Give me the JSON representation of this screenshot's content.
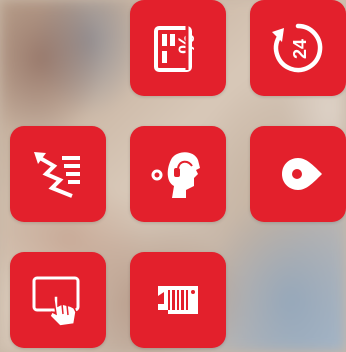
{
  "tiles": [
    {
      "id": "card-discount",
      "icon": "card-discount-icon",
      "symbol": "%"
    },
    {
      "id": "service-24h",
      "icon": "24-hour-service-icon",
      "symbol": "24"
    },
    {
      "id": "price-drop",
      "icon": "price-drop-chart-icon"
    },
    {
      "id": "customer-support",
      "icon": "support-agent-icon"
    },
    {
      "id": "store-location",
      "icon": "location-pin-icon"
    },
    {
      "id": "tablet-touch",
      "icon": "tablet-touch-icon"
    },
    {
      "id": "gift-card",
      "icon": "gift-card-barcode-icon"
    }
  ],
  "colors": {
    "tile": "#e3202c",
    "glyph": "#ffffff"
  }
}
